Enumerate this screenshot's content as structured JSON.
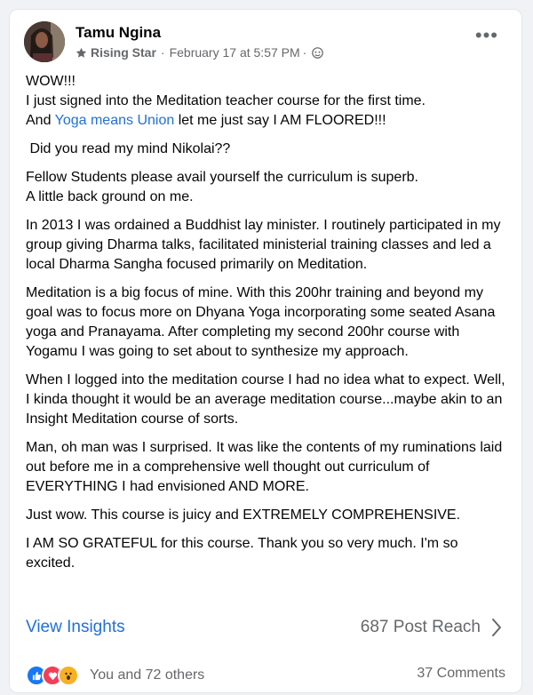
{
  "post": {
    "author": "Tamu Ngina",
    "badge": "Rising Star",
    "date": "February 17 at 5:57 PM",
    "separator1": "·",
    "separator2": "·",
    "more_label": "•••",
    "paragraphs": [
      {
        "line1": "WOW!!!",
        "line2": "I just signed into the Meditation teacher course for the first time.",
        "line3_pre": "And ",
        "line3_link": "Yoga means Union",
        "line3_post": " let me just say I AM FLOORED!!!"
      },
      " Did you read my mind Nikolai??",
      "Fellow Students please avail yourself the curriculum is superb.\nA little back ground on me.",
      "In 2013 I was ordained a Buddhist lay minister. I routinely participated in my group giving Dharma talks, facilitated ministerial training classes and led a local Dharma Sangha focused primarily on Meditation.",
      "Meditation is a big focus of mine. With this 200hr training and beyond my goal was to focus more on Dhyana Yoga incorporating some seated Asana yoga and Pranayama. After completing my second 200hr course with Yogamu I was going to set about to synthesize my approach.",
      "When I logged into the meditation course I had no idea what to expect. Well, I kinda thought it would be an average meditation course...maybe akin to an Insight Meditation course of sorts.",
      "Man, oh man was I surprised. It was like the contents of my ruminations laid out before me in a comprehensive well thought out curriculum of EVERYTHING I had envisioned AND MORE.",
      "Just wow. This course is juicy and EXTREMELY COMPREHENSIVE.",
      "I AM SO GRATEFUL for this course. Thank you so very much. I'm so excited."
    ],
    "view_insights": "View Insights",
    "reach": "687 Post Reach",
    "reactions_text": "You and 72 others",
    "comments": "37 Comments"
  },
  "icons": {
    "star": "star-icon",
    "globe": "globe-icon",
    "chevron": "chevron-right-icon",
    "like": "like-icon",
    "love": "love-icon",
    "wow": "wow-icon"
  },
  "colors": {
    "link": "#216fdb",
    "secondary_text": "#65676b",
    "like": "#1877f2",
    "love": "#f33e58",
    "wow": "#f7b125"
  }
}
